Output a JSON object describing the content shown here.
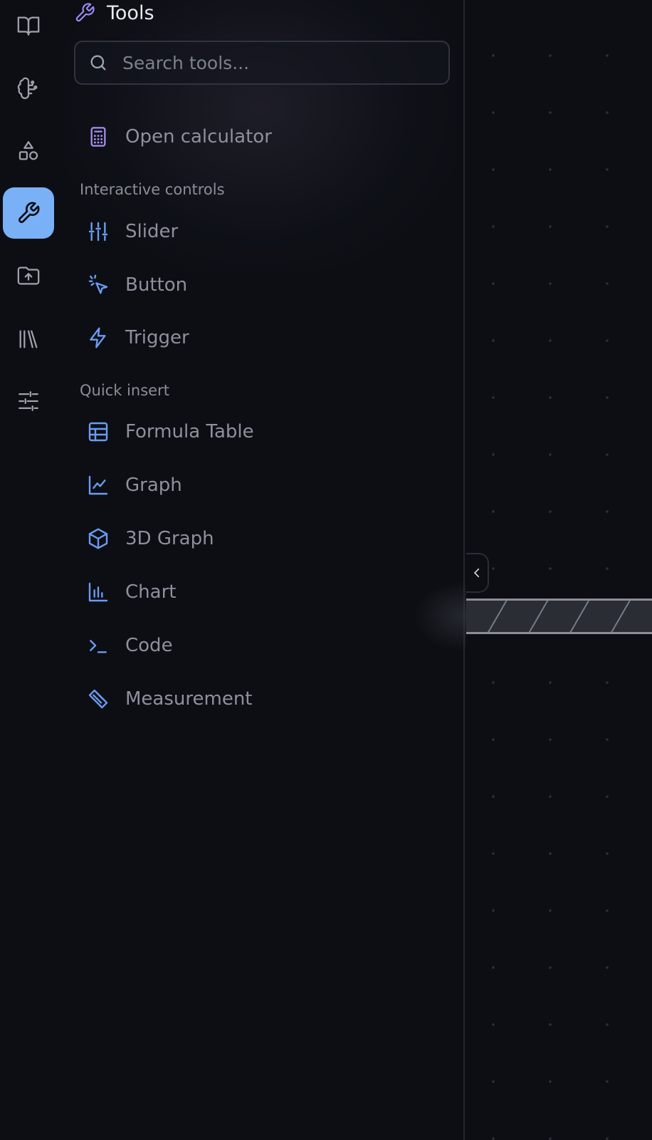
{
  "panel": {
    "title": "Tools",
    "search_placeholder": "Search tools...",
    "top_item": {
      "label": "Open calculator",
      "icon": "calculator-icon"
    },
    "sections": [
      {
        "label": "Interactive controls",
        "items": [
          {
            "label": "Slider",
            "icon": "sliders-icon"
          },
          {
            "label": "Button",
            "icon": "pointer-click-icon"
          },
          {
            "label": "Trigger",
            "icon": "lightning-icon"
          }
        ]
      },
      {
        "label": "Quick insert",
        "items": [
          {
            "label": "Formula Table",
            "icon": "table-icon"
          },
          {
            "label": "Graph",
            "icon": "line-chart-icon"
          },
          {
            "label": "3D Graph",
            "icon": "cube-icon"
          },
          {
            "label": "Chart",
            "icon": "bar-chart-icon"
          },
          {
            "label": "Code",
            "icon": "terminal-icon"
          },
          {
            "label": "Measurement",
            "icon": "ruler-icon"
          }
        ]
      }
    ]
  },
  "rail": {
    "items": [
      {
        "icon": "book-icon",
        "active": false
      },
      {
        "icon": "brain-icon",
        "active": false
      },
      {
        "icon": "shapes-icon",
        "active": false
      },
      {
        "icon": "wrench-icon",
        "active": true
      },
      {
        "icon": "folder-upload-icon",
        "active": false
      },
      {
        "icon": "library-icon",
        "active": false
      },
      {
        "icon": "settings-sliders-icon",
        "active": false
      }
    ]
  },
  "colors": {
    "background": "#0c0e14",
    "accent": "#7ab0f5",
    "tool_icon": "#6a9cf0",
    "header_icon": "#9a8cf0",
    "calculator_icon": "#a98ef0"
  }
}
